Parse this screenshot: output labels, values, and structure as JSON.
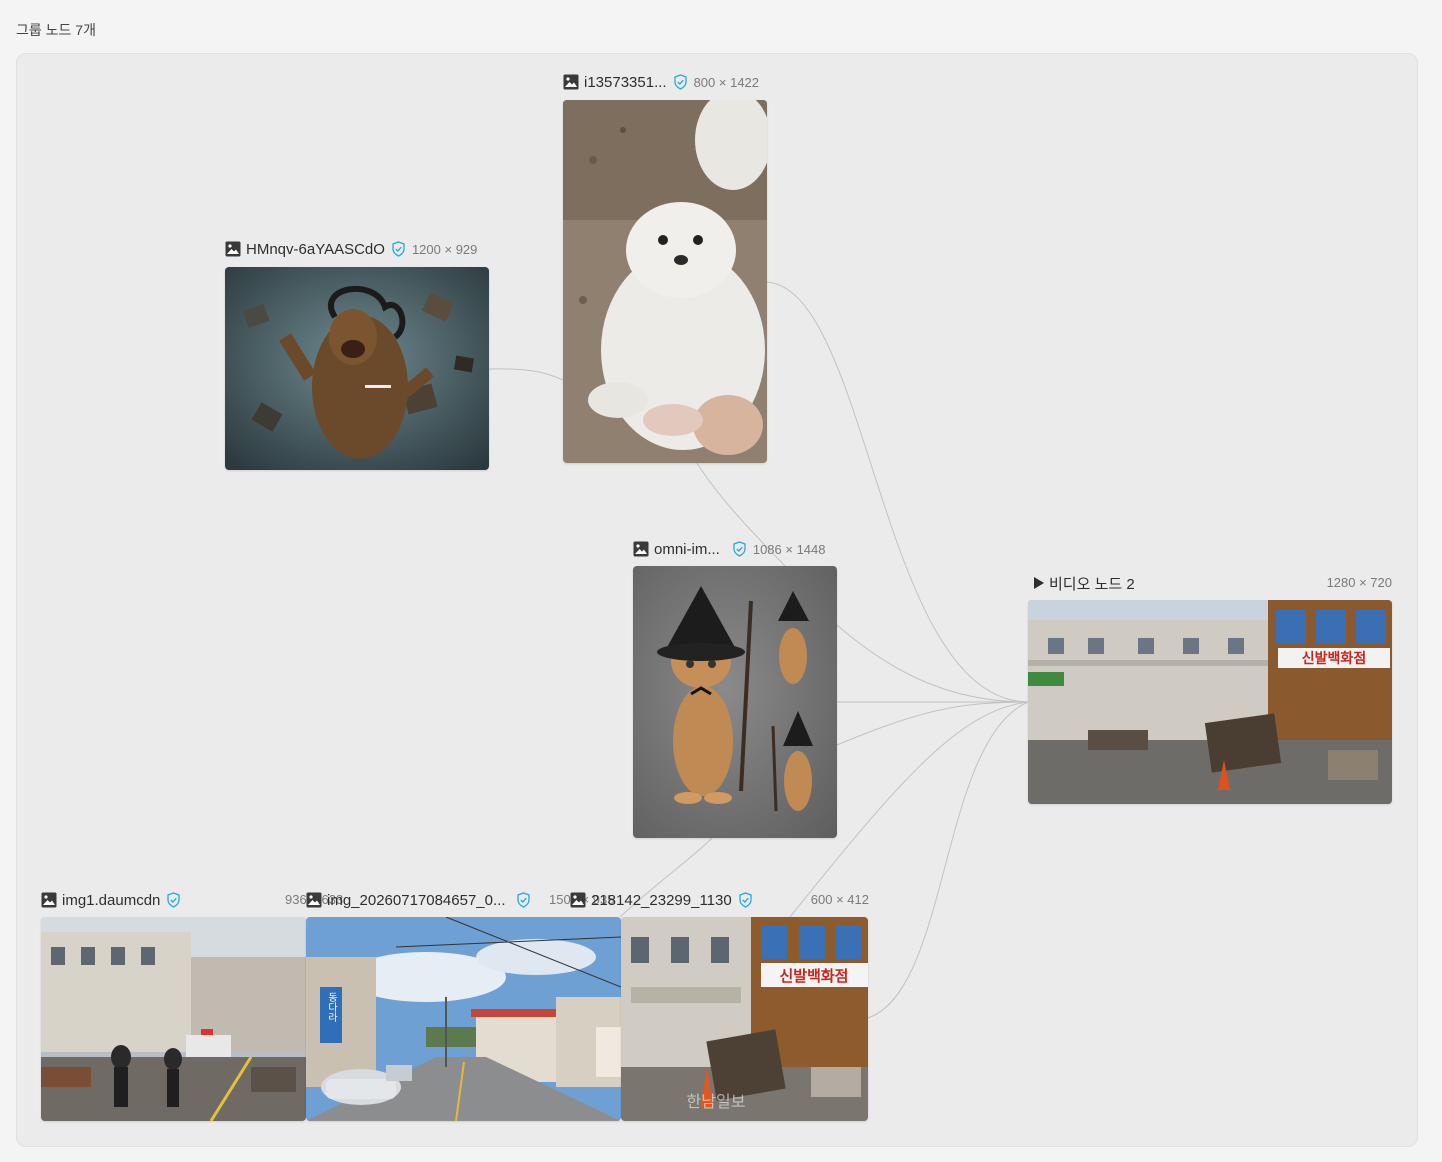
{
  "group": {
    "title": "그룹 노드 7개"
  },
  "nodes": {
    "puppy": {
      "name": "i13573351...",
      "dims": "800 × 1422",
      "kind": "image"
    },
    "predator": {
      "name": "HMnqv-6aYAASCdO",
      "dims": "1200 × 929",
      "kind": "image"
    },
    "cat": {
      "name": "omni-im...",
      "dims": "1086 × 1448",
      "kind": "image"
    },
    "video": {
      "name": "비디오 노드 2",
      "dims": "1280 × 720",
      "kind": "video"
    },
    "street_disaster": {
      "name": "img1.daumcdn",
      "dims": "936 × 633",
      "kind": "image"
    },
    "street_road": {
      "name": "img_20260717084657_0...",
      "dims": "1500 × 935",
      "kind": "image"
    },
    "shop_ruins": {
      "name": "218142_23299_1130",
      "dims": "600 × 412",
      "kind": "image"
    }
  },
  "signs": {
    "video_sign": "신발백화점",
    "shop_sign": "신발백화점",
    "road_sign": "동다라",
    "watermark": "한남일보"
  },
  "colors": {
    "verified": "#27a9d6",
    "edge": "#c2c2c2",
    "canvas": "#ebebeb",
    "page": "#f4f4f4"
  },
  "icons": {
    "image": "image-icon",
    "video": "play-icon",
    "verified": "shield-check-icon"
  }
}
